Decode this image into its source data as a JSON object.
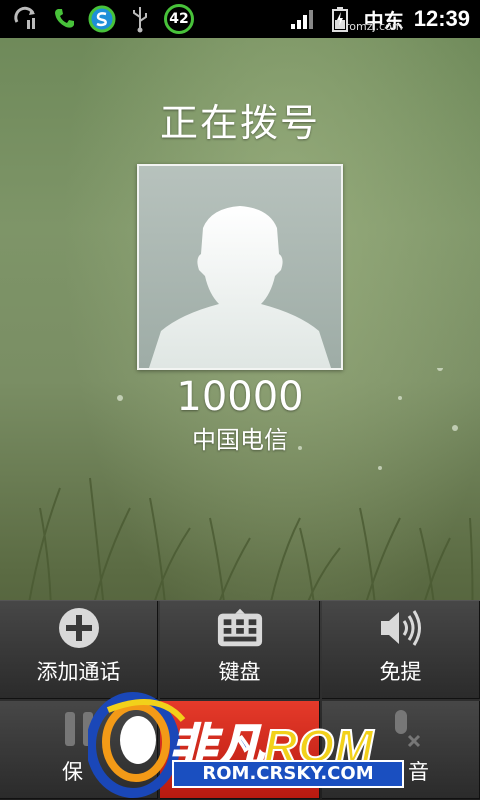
{
  "status_bar": {
    "time": "12:39",
    "carrier": "中东",
    "watermark": "romzj.com",
    "notification_badge": "42",
    "icons": [
      "sync-icon",
      "phone-call-icon",
      "app-s-icon",
      "usb-icon",
      "badge-42-icon",
      "signal-icon",
      "battery-charging-icon"
    ]
  },
  "call": {
    "status": "正在拨号",
    "number": "10000",
    "carrier_name": "中国电信"
  },
  "controls": {
    "add_call": "添加通话",
    "keypad": "键盘",
    "speaker": "免提",
    "hold_partial": "保",
    "mute_partial": "音"
  },
  "logo": {
    "name_part1": "非凡",
    "name_part2": "ROM",
    "url": "ROM.CRSKY.COM"
  },
  "colors": {
    "accent_green": "#48c23a",
    "end_call_red": "#e53a2a",
    "logo_blue": "#1a47b8",
    "logo_yellow": "#f2d11a"
  }
}
